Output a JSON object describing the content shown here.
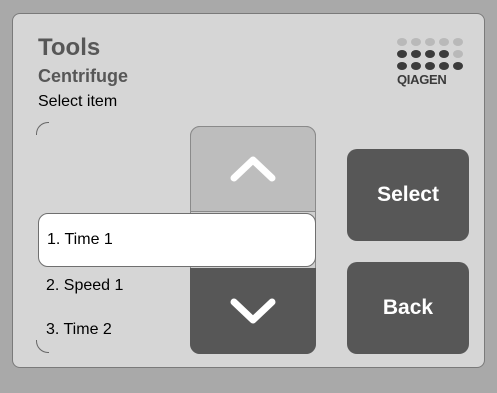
{
  "header": {
    "title": "Tools",
    "subtitle": "Centrifuge",
    "prompt": "Select item"
  },
  "logo": {
    "text": "QIAGEN"
  },
  "list": {
    "items": [
      {
        "label": "1. Time 1",
        "selected": true
      },
      {
        "label": "2. Speed 1",
        "selected": false
      },
      {
        "label": "3. Time 2",
        "selected": false
      }
    ]
  },
  "buttons": {
    "select_label": "Select",
    "back_label": "Back"
  },
  "icons": {
    "scroll_up": "chevron-up-icon",
    "scroll_down": "chevron-down-icon"
  }
}
